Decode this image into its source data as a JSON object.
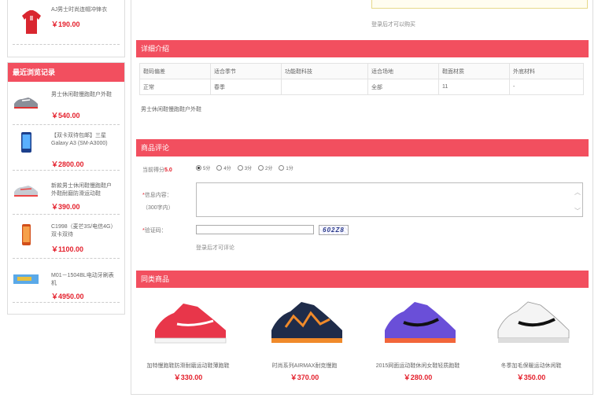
{
  "sidebar_top": {
    "title": "AJ男士时尚连帽冲锋衣",
    "price": "￥190.00"
  },
  "recent": {
    "heading": "最近浏览记录",
    "items": [
      {
        "title": "男士休闲鞋慢跑鞋户外鞋",
        "price": "￥540.00",
        "icon": "sneaker-gray"
      },
      {
        "title": "【双卡双待包邮】三星Galaxy A3 (SM-A3000)",
        "price": "￥2800.00",
        "icon": "phone-blue"
      },
      {
        "title": "新款男士休闲鞋慢跑鞋户外鞋耐磨防滑运动鞋",
        "price": "￥390.00",
        "icon": "sneaker-silver"
      },
      {
        "title": "C1998（麦芒3S/电信4G）双卡双待",
        "price": "￥1100.00",
        "icon": "phone-orange"
      },
      {
        "title": "M01－1504BL电动牙刷表机",
        "price": "￥4950.00",
        "icon": "device-blue"
      }
    ]
  },
  "buy_note": "登录后才可以购买",
  "details": {
    "heading": "详细介绍",
    "headers": [
      "鞋码偏差",
      "适合季节",
      "功能鞋科技",
      "适合场地",
      "鞋面材质",
      "外底材料"
    ],
    "values": [
      "正常",
      "春季",
      "",
      "全部",
      "11",
      "-"
    ],
    "desc": "男士休闲鞋慢跑鞋户外鞋"
  },
  "reviews": {
    "heading": "商品评论",
    "score_label": "当前得分",
    "score": "5.0",
    "options": [
      "5分",
      "4分",
      "3分",
      "2分",
      "1分"
    ],
    "content_label": "信息内容：",
    "content_limit": "（300字内）",
    "captcha_label": "验证码：",
    "captcha_text": "602Z8",
    "note": "登录后才可评论"
  },
  "similar": {
    "heading": "同类商品",
    "items": [
      {
        "title": "加特慢跑鞋防滑耐磨运动鞋薄跑鞋",
        "price": "￥330.00",
        "color": "#e8364a"
      },
      {
        "title": "时尚系列AIRMAX耐克慢跑",
        "price": "￥370.00",
        "color": "#f08a2a"
      },
      {
        "title": "2015网面运动鞋休闲女鞋轻质跑鞋",
        "price": "￥280.00",
        "color": "#6a4fd8"
      },
      {
        "title": "冬季加毛保暖运动休闲鞋",
        "price": "￥350.00",
        "color": "#ffffff"
      }
    ]
  },
  "colors": {
    "accent": "#f24f5f",
    "price": "#e4202c"
  }
}
